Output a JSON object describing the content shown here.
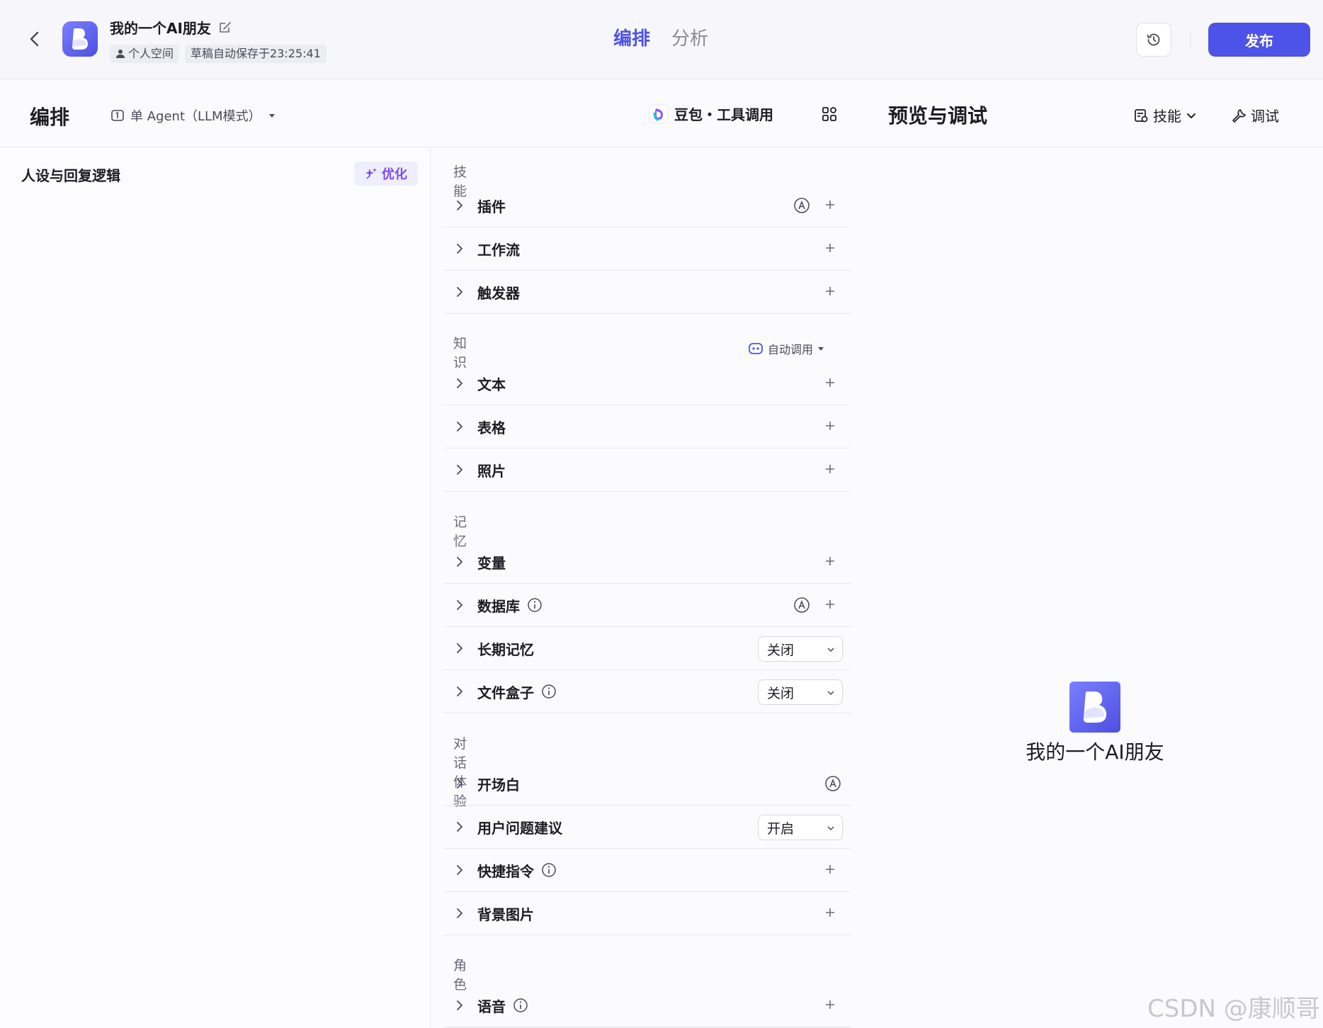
{
  "header": {
    "bot_name": "我的一个AI朋友",
    "space_tag": "个人空间",
    "draft_status": "草稿自动保存于23:25:41",
    "tabs": [
      "编排",
      "分析"
    ],
    "active_tab": "编排",
    "publish_label": "发布",
    "accent_color": "#4d53e8"
  },
  "subbar": {
    "section_title": "编排",
    "mode_label": "单 Agent（LLM模式）",
    "model_label": "豆包・工具调用",
    "preview_title": "预览与调试",
    "skills_label": "技能",
    "debug_label": "调试"
  },
  "persona": {
    "title": "人设与回复逻辑",
    "optimize_label": "优化"
  },
  "groups": {
    "skills": "技能",
    "knowledge": "知识",
    "memory": "记忆",
    "dialog": "对话体验",
    "role": "角色"
  },
  "knowledge_mode": "自动调用",
  "rows": {
    "plugin": "插件",
    "workflow": "工作流",
    "trigger": "触发器",
    "text": "文本",
    "table": "表格",
    "photo": "照片",
    "variable": "变量",
    "database": "数据库",
    "long_term_memory": "长期记忆",
    "long_term_memory_value": "关闭",
    "file_box": "文件盒子",
    "file_box_value": "关闭",
    "opening": "开场白",
    "suggestion": "用户问题建议",
    "suggestion_value": "开启",
    "shortcut": "快捷指令",
    "background": "背景图片",
    "voice": "语音"
  },
  "preview": {
    "bot_name": "我的一个AI朋友"
  },
  "watermark": "CSDN @康顺哥"
}
